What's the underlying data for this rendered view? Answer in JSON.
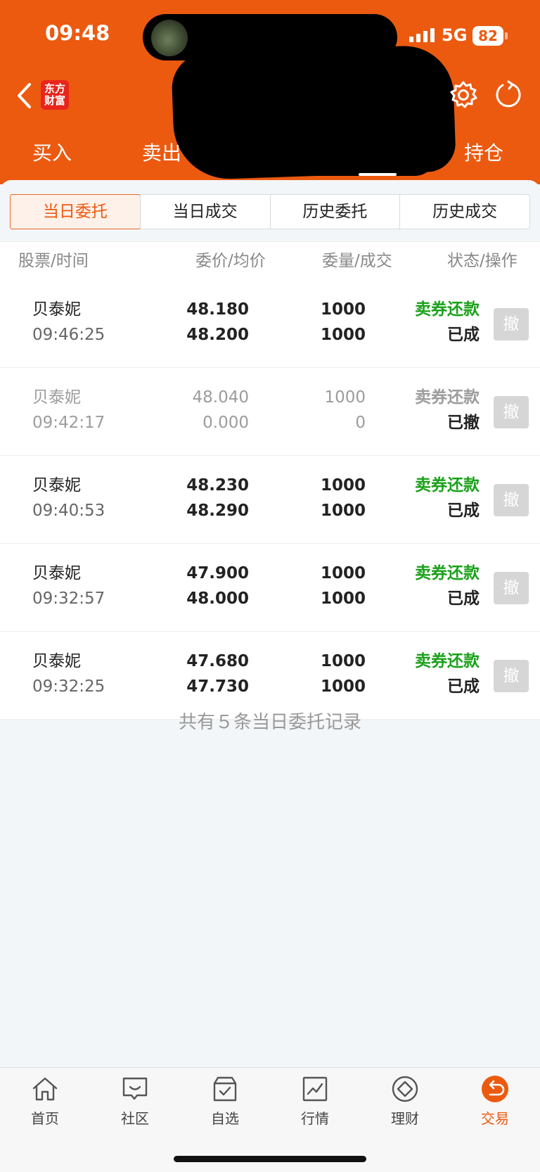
{
  "status_bar": {
    "time": "09:48",
    "network": "5G",
    "battery": "82"
  },
  "header": {
    "logo_line1": "东方",
    "logo_line2": "财富",
    "nav": [
      "买入",
      "卖出",
      "持仓"
    ]
  },
  "tabs": [
    "当日委托",
    "当日成交",
    "历史委托",
    "历史成交"
  ],
  "active_tab": 0,
  "columns": [
    "股票/时间",
    "委价/均价",
    "委量/成交",
    "状态/操作"
  ],
  "orders": [
    {
      "name": "贝泰妮",
      "time": "09:46:25",
      "order_price": "48.180",
      "avg_price": "48.200",
      "order_qty": "1000",
      "filled_qty": "1000",
      "type": "卖券还款",
      "status": "已成",
      "action": "撤"
    },
    {
      "name": "贝泰妮",
      "time": "09:42:17",
      "order_price": "48.040",
      "avg_price": "0.000",
      "order_qty": "1000",
      "filled_qty": "0",
      "type": "卖券还款",
      "status": "已撤",
      "action": "撤"
    },
    {
      "name": "贝泰妮",
      "time": "09:40:53",
      "order_price": "48.230",
      "avg_price": "48.290",
      "order_qty": "1000",
      "filled_qty": "1000",
      "type": "卖券还款",
      "status": "已成",
      "action": "撤"
    },
    {
      "name": "贝泰妮",
      "time": "09:32:57",
      "order_price": "47.900",
      "avg_price": "48.000",
      "order_qty": "1000",
      "filled_qty": "1000",
      "type": "卖券还款",
      "status": "已成",
      "action": "撤"
    },
    {
      "name": "贝泰妮",
      "time": "09:32:25",
      "order_price": "47.680",
      "avg_price": "47.730",
      "order_qty": "1000",
      "filled_qty": "1000",
      "type": "卖券还款",
      "status": "已成",
      "action": "撤"
    }
  ],
  "summary": "共有５条当日委托记录",
  "tabbar": [
    {
      "label": "首页",
      "icon": "home-icon"
    },
    {
      "label": "社区",
      "icon": "chat-icon"
    },
    {
      "label": "自选",
      "icon": "watchlist-icon"
    },
    {
      "label": "行情",
      "icon": "market-chart-icon"
    },
    {
      "label": "理财",
      "icon": "diamond-icon"
    },
    {
      "label": "交易",
      "icon": "trade-icon"
    }
  ],
  "colors": {
    "brand": "#ec5a10",
    "positive": "#1aa11a",
    "logo_red": "#e8251b"
  }
}
